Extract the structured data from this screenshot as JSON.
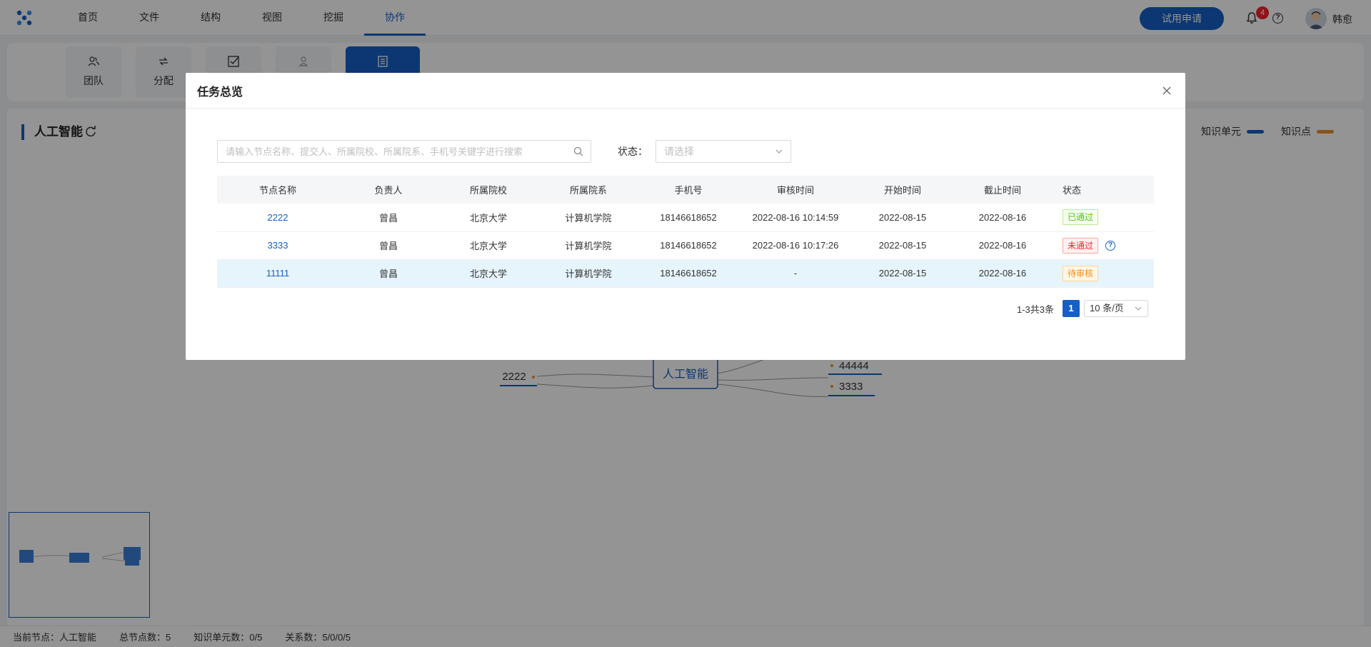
{
  "nav": {
    "items": [
      "首页",
      "文件",
      "结构",
      "视图",
      "挖掘",
      "协作"
    ],
    "trial_button": "试用申请",
    "notification_count": "4",
    "username": "韩愈"
  },
  "toolbar": {
    "tools": [
      {
        "label": "团队",
        "icon": "team-icon"
      },
      {
        "label": "分配",
        "icon": "assign-icon"
      },
      {
        "label": "",
        "icon": "checkbox-icon"
      },
      {
        "label": "",
        "icon": "user-icon"
      },
      {
        "label": "",
        "icon": "document-icon"
      }
    ]
  },
  "canvas": {
    "title": "人工智能",
    "legend": [
      {
        "label": "知识单元",
        "color": "#1660c5"
      },
      {
        "label": "知识点",
        "color": "#e8912f"
      }
    ],
    "mindmap": {
      "center": "人工智能",
      "left_nodes": [
        "2222"
      ],
      "right_nodes": [
        "44444",
        "3333"
      ]
    }
  },
  "statusbar": {
    "current_node": "当前节点：人工智能",
    "total_nodes": "总节点数：5",
    "knowledge_units": "知识单元数：0/5",
    "relations": "关系数：5/0/0/5"
  },
  "modal": {
    "title": "任务总览",
    "search_placeholder": "请输入节点名称、提交人、所属院校、所属院系、手机号关键字进行搜索",
    "status_label": "状态：",
    "status_placeholder": "请选择",
    "columns": [
      "节点名称",
      "负责人",
      "所属院校",
      "所属院系",
      "手机号",
      "审核时间",
      "开始时间",
      "截止时间",
      "状态"
    ],
    "rows": [
      {
        "name": "2222",
        "owner": "曾昌",
        "school": "北京大学",
        "dept": "计算机学院",
        "phone": "18146618652",
        "review_time": "2022-08-16 10:14:59",
        "start": "2022-08-15",
        "end": "2022-08-16",
        "status": "已通过",
        "status_type": "ok"
      },
      {
        "name": "3333",
        "owner": "曾昌",
        "school": "北京大学",
        "dept": "计算机学院",
        "phone": "18146618652",
        "review_time": "2022-08-16 10:17:26",
        "start": "2022-08-15",
        "end": "2022-08-16",
        "status": "未通过",
        "status_type": "fail"
      },
      {
        "name": "11111",
        "owner": "曾昌",
        "school": "北京大学",
        "dept": "计算机学院",
        "phone": "18146618652",
        "review_time": "-",
        "start": "2022-08-15",
        "end": "2022-08-16",
        "status": "待审核",
        "status_type": "wait"
      }
    ],
    "pagination": {
      "total": "1-3共3条",
      "current_page": "1",
      "page_size": "10 条/页"
    }
  }
}
